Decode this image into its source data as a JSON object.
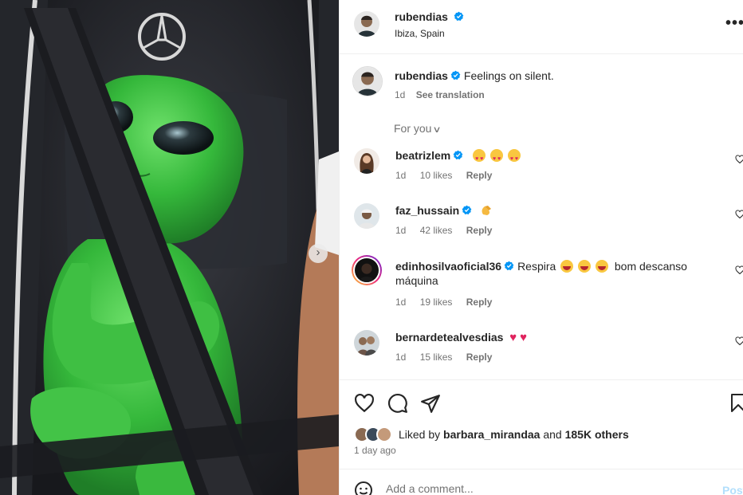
{
  "post": {
    "username": "rubendias",
    "location": "Ibiza, Spain",
    "more_label": "•••"
  },
  "caption": {
    "username": "rubendias",
    "text": "Feelings on silent.",
    "time": "1d",
    "translate": "See translation"
  },
  "filter": {
    "label": "For you"
  },
  "comments": [
    {
      "username": "beatrizlem",
      "text": "",
      "emojis": [
        "heart-eyes",
        "heart-eyes",
        "heart-eyes"
      ],
      "time": "1d",
      "likes": "10 likes",
      "reply": "Reply",
      "verified": true
    },
    {
      "username": "faz_hussain",
      "text": "",
      "emojis": [
        "clap"
      ],
      "time": "1d",
      "likes": "42 likes",
      "reply": "Reply",
      "verified": true
    },
    {
      "username": "edinhosilvaoficial36",
      "text": "Respira",
      "text_after": "bom descanso",
      "text_line2": "máquina",
      "emojis": [
        "laugh",
        "laugh",
        "laugh"
      ],
      "time": "1d",
      "likes": "19 likes",
      "reply": "Reply",
      "verified": true
    },
    {
      "username": "bernardetealvesdias",
      "text": "",
      "emojis": [
        "red-heart",
        "red-heart"
      ],
      "time": "1d",
      "likes": "15 likes",
      "reply": "Reply",
      "verified": false
    }
  ],
  "likes": {
    "prefix": "Liked by",
    "user": "barbara_mirandaa",
    "joiner": "and",
    "others": "185K others",
    "time_ago": "1 day ago"
  },
  "add_comment": {
    "placeholder": "Add a comment...",
    "post_label": "Post"
  },
  "colors": {
    "verified": "#0095f6",
    "muted": "#737373",
    "post_disabled": "#b2dffc",
    "alien_green": "#3fbf43"
  }
}
